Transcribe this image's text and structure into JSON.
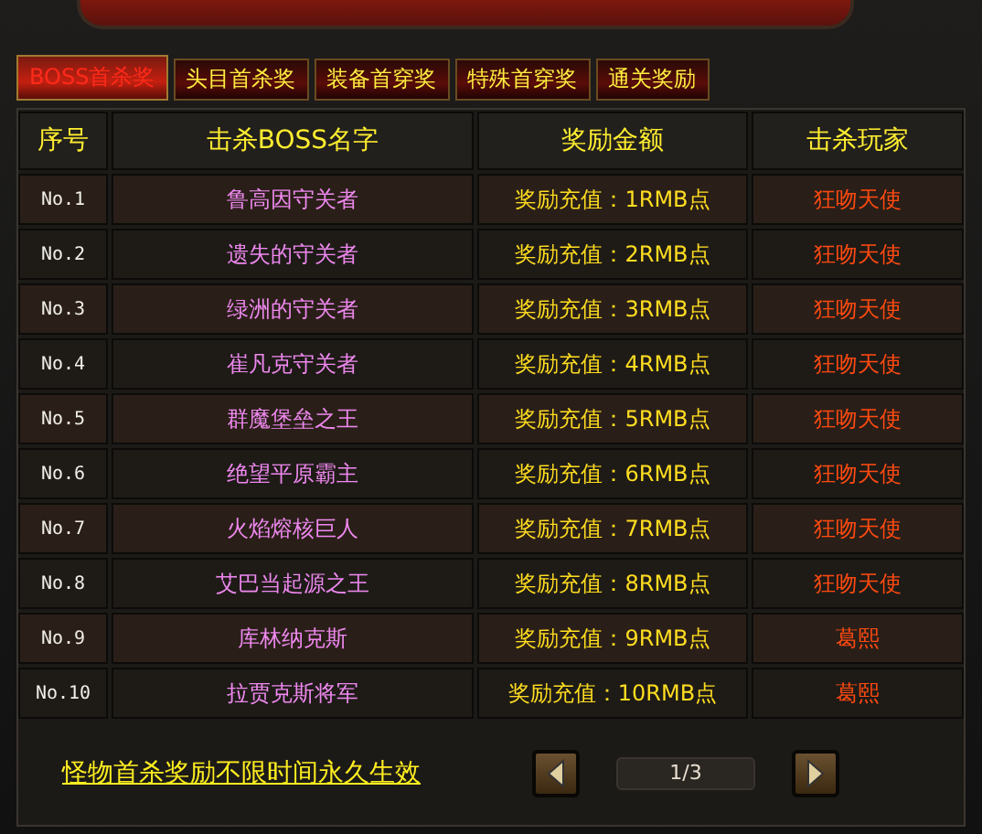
{
  "tabs": [
    {
      "label": "BOSS首杀奖",
      "selected": true
    },
    {
      "label": "头目首杀奖",
      "selected": false
    },
    {
      "label": "装备首穿奖",
      "selected": false
    },
    {
      "label": "特殊首穿奖",
      "selected": false
    },
    {
      "label": "通关奖励",
      "selected": false
    }
  ],
  "table": {
    "columns": [
      "序号",
      "击杀BOSS名字",
      "奖励金额",
      "击杀玩家"
    ],
    "rows": [
      [
        "No.1",
        "鲁高因守关者",
        "奖励充值：1RMB点",
        "狂吻天使"
      ],
      [
        "No.2",
        "遗失的守关者",
        "奖励充值：2RMB点",
        "狂吻天使"
      ],
      [
        "No.3",
        "绿洲的守关者",
        "奖励充值：3RMB点",
        "狂吻天使"
      ],
      [
        "No.4",
        "崔凡克守关者",
        "奖励充值：4RMB点",
        "狂吻天使"
      ],
      [
        "No.5",
        "群魔堡垒之王",
        "奖励充值：5RMB点",
        "狂吻天使"
      ],
      [
        "No.6",
        "绝望平原霸主",
        "奖励充值：6RMB点",
        "狂吻天使"
      ],
      [
        "No.7",
        "火焰熔核巨人",
        "奖励充值：7RMB点",
        "狂吻天使"
      ],
      [
        "No.8",
        "艾巴当起源之王",
        "奖励充值：8RMB点",
        "狂吻天使"
      ],
      [
        "No.9",
        "库林纳克斯",
        "奖励充值：9RMB点",
        "葛熙"
      ],
      [
        "No.10",
        "拉贾克斯将军",
        "奖励充值：10RMB点",
        "葛熙"
      ]
    ]
  },
  "footer": {
    "note": "怪物首杀奖励不限时间永久生效",
    "page": "1/3"
  }
}
